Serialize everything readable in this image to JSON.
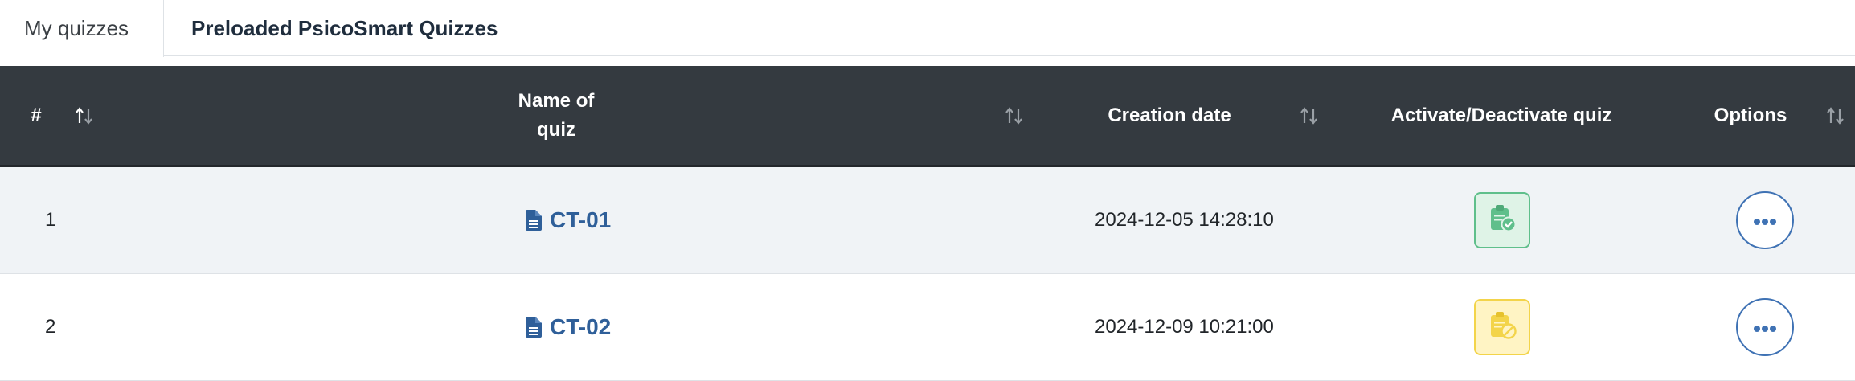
{
  "tabs": [
    {
      "label": "My quizzes",
      "active": true
    },
    {
      "label": "Preloaded PsicoSmart Quizzes",
      "active": false
    }
  ],
  "table": {
    "headers": {
      "index": "#",
      "name_line1": "Name of",
      "name_line2": "quiz",
      "creation_date": "Creation date",
      "activate": "Activate/Deactivate quiz",
      "options": "Options"
    },
    "rows": [
      {
        "index": "1",
        "name": "CT-01",
        "creation_date": "2024-12-05 14:28:10",
        "status": "active"
      },
      {
        "index": "2",
        "name": "CT-02",
        "creation_date": "2024-12-09 10:21:00",
        "status": "inactive"
      }
    ]
  },
  "colors": {
    "header_bg": "#343a40",
    "link": "#2f5f99",
    "active_green": "#5fbf8b",
    "inactive_yellow": "#f3d44a",
    "options_blue": "#3f72b4"
  },
  "icons": {
    "sort": "sort-up-down-icon",
    "document": "file-text-icon",
    "active_status": "clipboard-check-icon",
    "inactive_status": "clipboard-ban-icon",
    "options": "ellipsis-icon"
  }
}
